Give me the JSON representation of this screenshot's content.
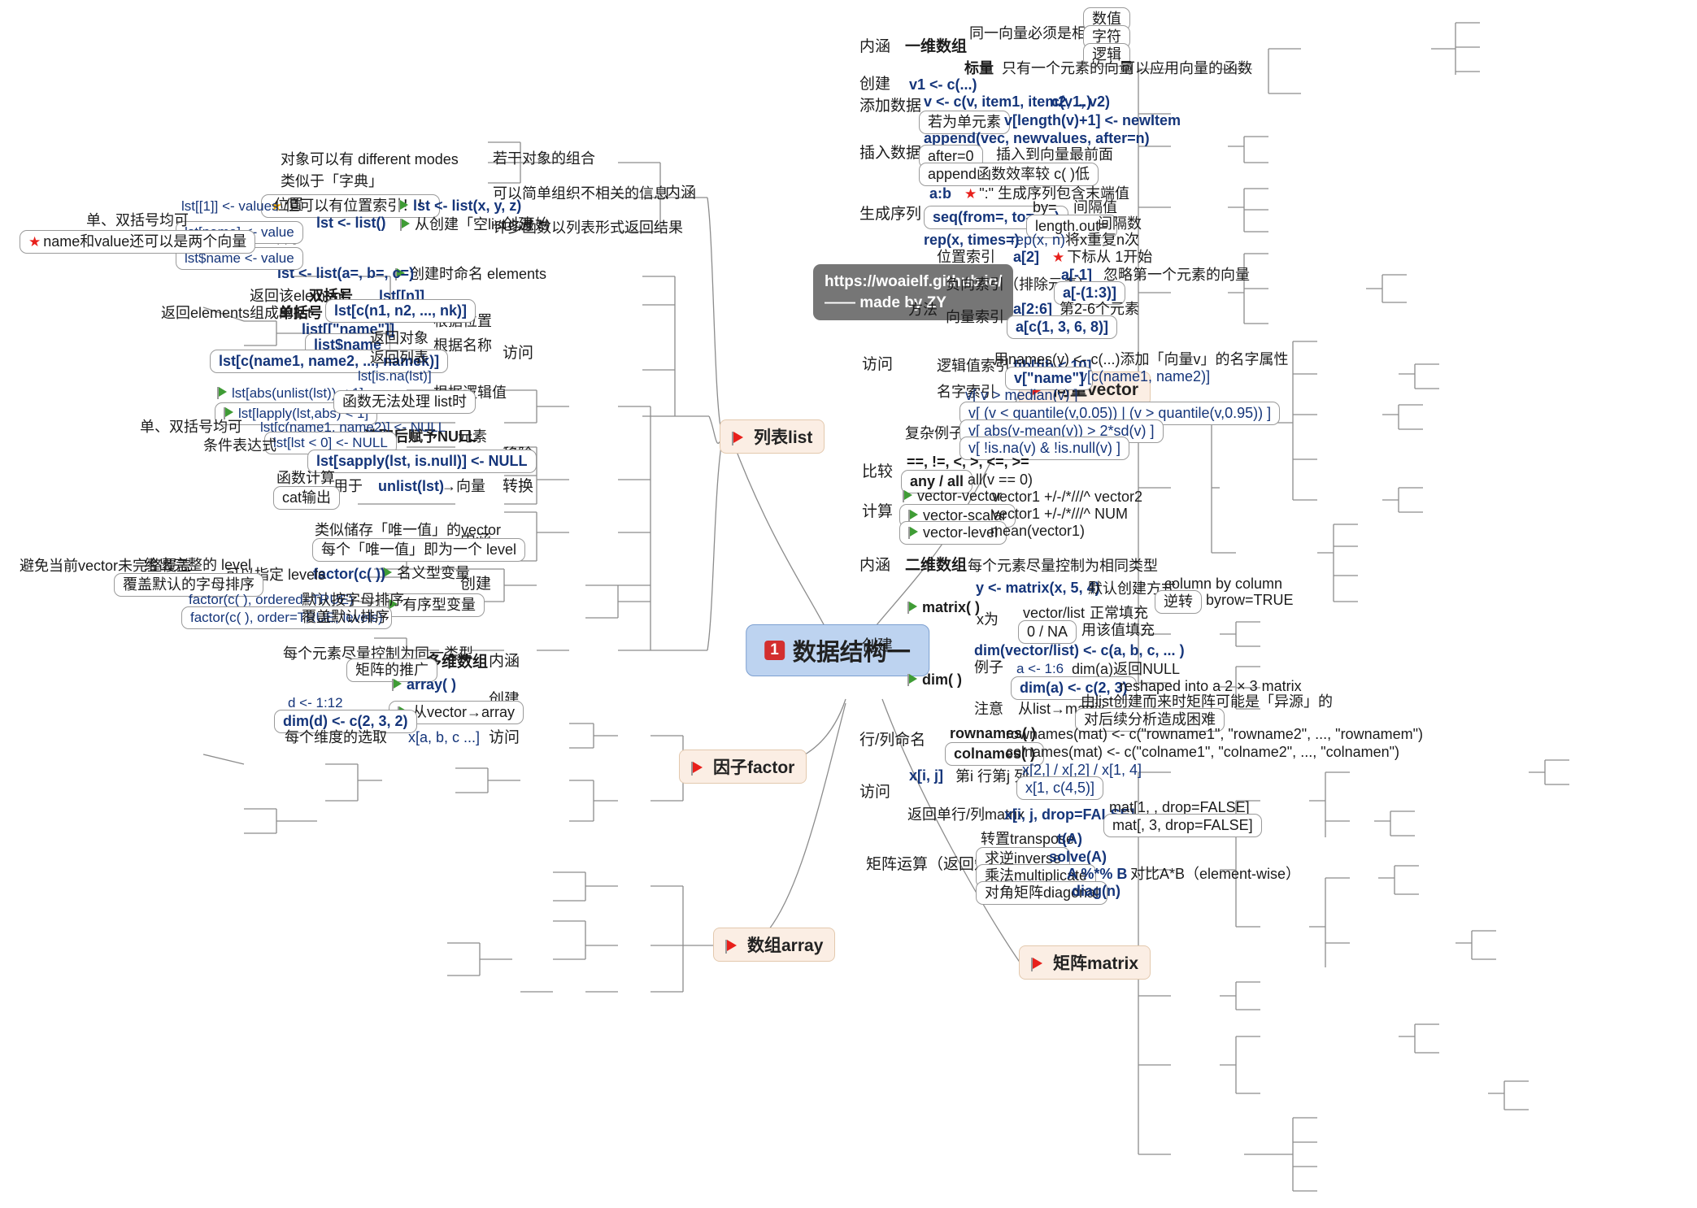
{
  "root": {
    "badge": "1",
    "label": "数据结构一"
  },
  "url_note": {
    "line1": "https://woaielf.github.io/",
    "line2": "—— made by ZY"
  },
  "branches": {
    "list": "列表list",
    "vector": "向量vector",
    "factor": "因子factor",
    "array": "数组array",
    "matrix": "矩阵matrix"
  },
  "list": {
    "neihan": "内涵",
    "neihan_items": [
      "若干对象的组合",
      "可以简单组织不相关的信息",
      "许多函数以列表形式返回结果"
    ],
    "neihan_sub": [
      "对象可以有 different modes",
      "类似于「字典」",
      "但可以有位置索引！！"
    ],
    "chuangjian": "创建",
    "chuangjian_items": [
      "lst <- list(x, y, z)",
      "从创建「空list」开始",
      "创建时命名 elements"
    ],
    "lst_list": "lst <- list()",
    "lst_list_abc": "lst <- list(a=, b=, c=)",
    "weizhi": "位置",
    "mingzi": "名字",
    "assign_pos": "lst[[1]] <- values",
    "assign_name1": "lst[name] <- value",
    "assign_name2": "lst$name <- value",
    "dan_shuang_1": "单、双括号均可",
    "name_value_note": "name和value还可以是两个向量",
    "fangwen": "访问",
    "genju_weizhi": "根据位置",
    "genju_mingcheng": "根据名称",
    "genju_luoji": "根据逻辑值",
    "shuangkuohao": "双括号",
    "dankuohao": "单括号",
    "fanhui_element": "返回该element",
    "fanhui_list": "返回elements组成的list",
    "lst_nn": "lst[[n]]",
    "lst_cn": "lst[c(n1, n2, ..., nk)]",
    "list_name_bracket": "list[[\"name\"]]",
    "list_dollar_name": "list$name",
    "lst_cnames": "lst[c(name1, name2, ..., namek)]",
    "fanhui_duixiang": "返回对象",
    "fanhui_liebiao": "返回列表",
    "lst_isna": "lst[is.na(lst)]",
    "lst_abs_unlist": "lst[abs(unlist(lst)) < 1]",
    "lst_lapply": "lst[lapply(lst,abs) < 1]",
    "hanshu_wufa": "函数无法处理 list时",
    "yichu": "移除",
    "yuansu": "元素",
    "kongzhi": "空值",
    "xuanqu_null": "选取后赋予NULL",
    "dan_shuang_2": "单、双括号均可",
    "tiaojian_biaodashi": "条件表达式",
    "lst_cnames_null": "lst[c(name1, name2)] <- NULL",
    "lst_lt0_null": "lst[lst < 0] <- NULL",
    "lst_sapply_null": "lst[sapply(lst, is.null)] <- NULL",
    "zhuanhuan": "转换",
    "xiangliang": "→向量",
    "unlist": "unlist(lst)",
    "yongyu": "用于",
    "hanshu_jisuan": "函数计算",
    "cat_shuchu": "cat输出"
  },
  "vector": {
    "neihan": "内涵",
    "yiwei_shuzu": "一维数组",
    "tongyi_xiangliang": "同一向量必须是相同类型",
    "types": [
      "数值",
      "字符",
      "逻辑"
    ],
    "biaoliang": "标量",
    "zhiyou_yige": "只有一个元素的向量",
    "keyi_yingyong": "可以应用向量的函数",
    "chuangjian": "创建",
    "v1_c": "v1 <- c(...)",
    "tianjia_shuju": "添加数据",
    "v_c_item": "v <- c(v, item1, item2, ...)",
    "c_v1_v2": "c(v1, v2)",
    "ruowei_danyuansu": "若为单元素",
    "v_length": "v[length(v)+1] <- newItem",
    "charu_shuju": "插入数据",
    "append_fn": "append(vec, newvalues, after=n)",
    "after0": "after=0",
    "charu_zuiqian": "插入到向量最前面",
    "append_xiaolv": "append函数效率较 c( )低",
    "shengcheng_xulie": "生成序列",
    "ab": "a:b",
    "colon_note": "\":\" 生成序列包含末端值",
    "seq_fn": "seq(from=, to=, ...)",
    "by_eq": "by=",
    "jiangeZhi": "间隔值",
    "length_out": "length.out=",
    "jiangeShu": "间隔数",
    "rep_fn": "rep(x, times=)",
    "rep_xn": "rep(x, n)",
    "jiang_x_chongfu": "将x重复n次",
    "fangwen": "访问",
    "fangfa": "方法",
    "weizhi_suoyin": "位置索引",
    "a2": "a[2]",
    "xiabiao_note": "下标从 1开始",
    "fuxiang_suoyin": "负向索引（排除元素）",
    "a_neg1": "a[-1]",
    "hulue_diyige": "忽略第一个元素的向量",
    "a_neg13": "a[-(1:3)]",
    "xiangliang_suoyin": "向量索引",
    "a26": "a[2:6]",
    "di26ge": "第2-6个元素",
    "a_c1368": "a[c(1, 3, 6, 8)]",
    "luoji_suoyin": "逻辑值索引",
    "fib_lt10": "fib[fib < 10]",
    "mingzi_suoyin": "名字索引",
    "names_note": "用names(v) <- c(...)添加「向量v」的名字属性",
    "v_name": "v[\"name\"]",
    "v_cname": "v[c(name1, name2)]",
    "fuza_lizi": "复杂例子",
    "complex": [
      "v[ v > median(v) ]",
      "v[ (v < quantile(v,0.05)) | (v > quantile(v,0.95)) ]",
      "v[ abs(v-mean(v)) > 2*sd(v) ]",
      "v[ !is.na(v) & !is.null(v) ]"
    ],
    "bijiao": "比较",
    "operators": "==, !=, <, >, <=, >=",
    "any_all": "any / all",
    "all_v0": "all(v == 0)",
    "jisuan": "计算",
    "calc": [
      {
        "name": "vector-vector",
        "expr": "vector1 +/-/*///^ vector2"
      },
      {
        "name": "vector-scalar",
        "expr": "vector1 +/-/*///^ NUM"
      },
      {
        "name": "vector-level",
        "expr": "mean(vector1)"
      }
    ]
  },
  "factor": {
    "neihan": "内涵",
    "neihan_items": [
      "类似储存「唯一值」的vector",
      "每个「唯一值」即为一个 level"
    ],
    "chuangjian": "创建",
    "mingyi": "名义型变量",
    "youxu": "有序型变量",
    "factor_c": "factor(c( ))",
    "keyi_zhiding": "可以指定 levels",
    "geichu_wanzheng": "给出完整的 level",
    "fugai_zimu": "覆盖默认的字母排序",
    "bimian": "避免当前vector未完整覆盖",
    "factor_ordered": "factor(c( ), ordered=TRUE)",
    "moren_zimu": "默认按字母排序",
    "factor_order_levels": "factor(c( ), order=TRUE, levels)",
    "fugai_moren": "覆盖默认排序"
  },
  "array": {
    "neihan": "内涵",
    "duowei_shuzu": "多维数组",
    "meige_yuansu": "每个元素尽量控制为同一类型",
    "juzhen_tuiguang": "矩阵的推广",
    "chuangjian": "创建",
    "array_fn": "array( )",
    "cong_vector": "从vector→array",
    "d_112": "d <- 1:12",
    "dim_d": "dim(d) <- c(2, 3, 2)",
    "fangwen": "访问",
    "meige_weidu": "每个维度的选取",
    "x_abc": "x[a, b, c ...]"
  },
  "matrix": {
    "neihan": "内涵",
    "erwei_shuzu": "二维数组",
    "meige_yuansu": "每个元素尽量控制为相同类型",
    "chuangjian": "创建",
    "matrix_fn": "matrix( )",
    "y_matrix": "y <- matrix(x, 5, 4)",
    "moren_chuangjian": "默认创建方式",
    "column_by_column": "column by column",
    "nizhuan": "逆转",
    "byrow_true": "byrow=TRUE",
    "x_wei": "x为",
    "vector_list": "vector/list",
    "zhengchang_tianchong": "正常填充",
    "zero_na": "0 / NA",
    "yonggai_tianchong": "用该值填充",
    "dim_fn": "dim( )",
    "dim_vector_list": "dim(vector/list) <- c(a, b, c, ... )",
    "lizi": "例子",
    "a_16": "a <- 1:6",
    "dim_a_null": "dim(a)返回NULL",
    "dim_a_c23": "dim(a) <- c(2, 3)",
    "reshaped": "reshaped into a 2 × 3 matrix",
    "zhuyi": "注意",
    "cong_list": "从list→matrix",
    "yiyuan": "由list创建而来时矩阵可能是「异源」的",
    "houxu_fenxi": "对后续分析造成困难",
    "hangliemingming": "行/列命名",
    "rownames_fn": "rownames( )",
    "rownames_expr": "rownames(mat) <- c(\"rowname1\", \"rowname2\", ..., \"rownamem\")",
    "colnames_fn": "colnames( )",
    "colnames_expr": "colnames(mat) <- c(\"colname1\", \"colname2\", ..., \"colnamen\")",
    "fangwen": "访问",
    "x_ij": "x[i, j]",
    "di_i_hang": "第i 行第j 列",
    "x_examples1": "x[2,] / x[,2] / x[1, 4]",
    "x_examples2": "x[1, c(4,5)]",
    "fanhui_danhang": "返回单行/列matrix",
    "x_ij_drop": "x[i, j, drop=FALSE]",
    "mat_drop1": "mat[1, , drop=FALSE]",
    "mat_drop2": "mat[, 3, drop=FALSE]",
    "juzhen_yunsuan": "矩阵运算（返回矩阵）",
    "ops": [
      {
        "name": "转置transpose",
        "expr": "t(A)",
        "note": ""
      },
      {
        "name": "求逆inverse",
        "expr": "solve(A)",
        "note": ""
      },
      {
        "name": "乘法multiplicate",
        "expr": "A %*% B",
        "note": "对比A*B（element-wise）"
      },
      {
        "name": "对角矩阵diagonal",
        "expr": "diag(n)",
        "note": ""
      }
    ]
  }
}
